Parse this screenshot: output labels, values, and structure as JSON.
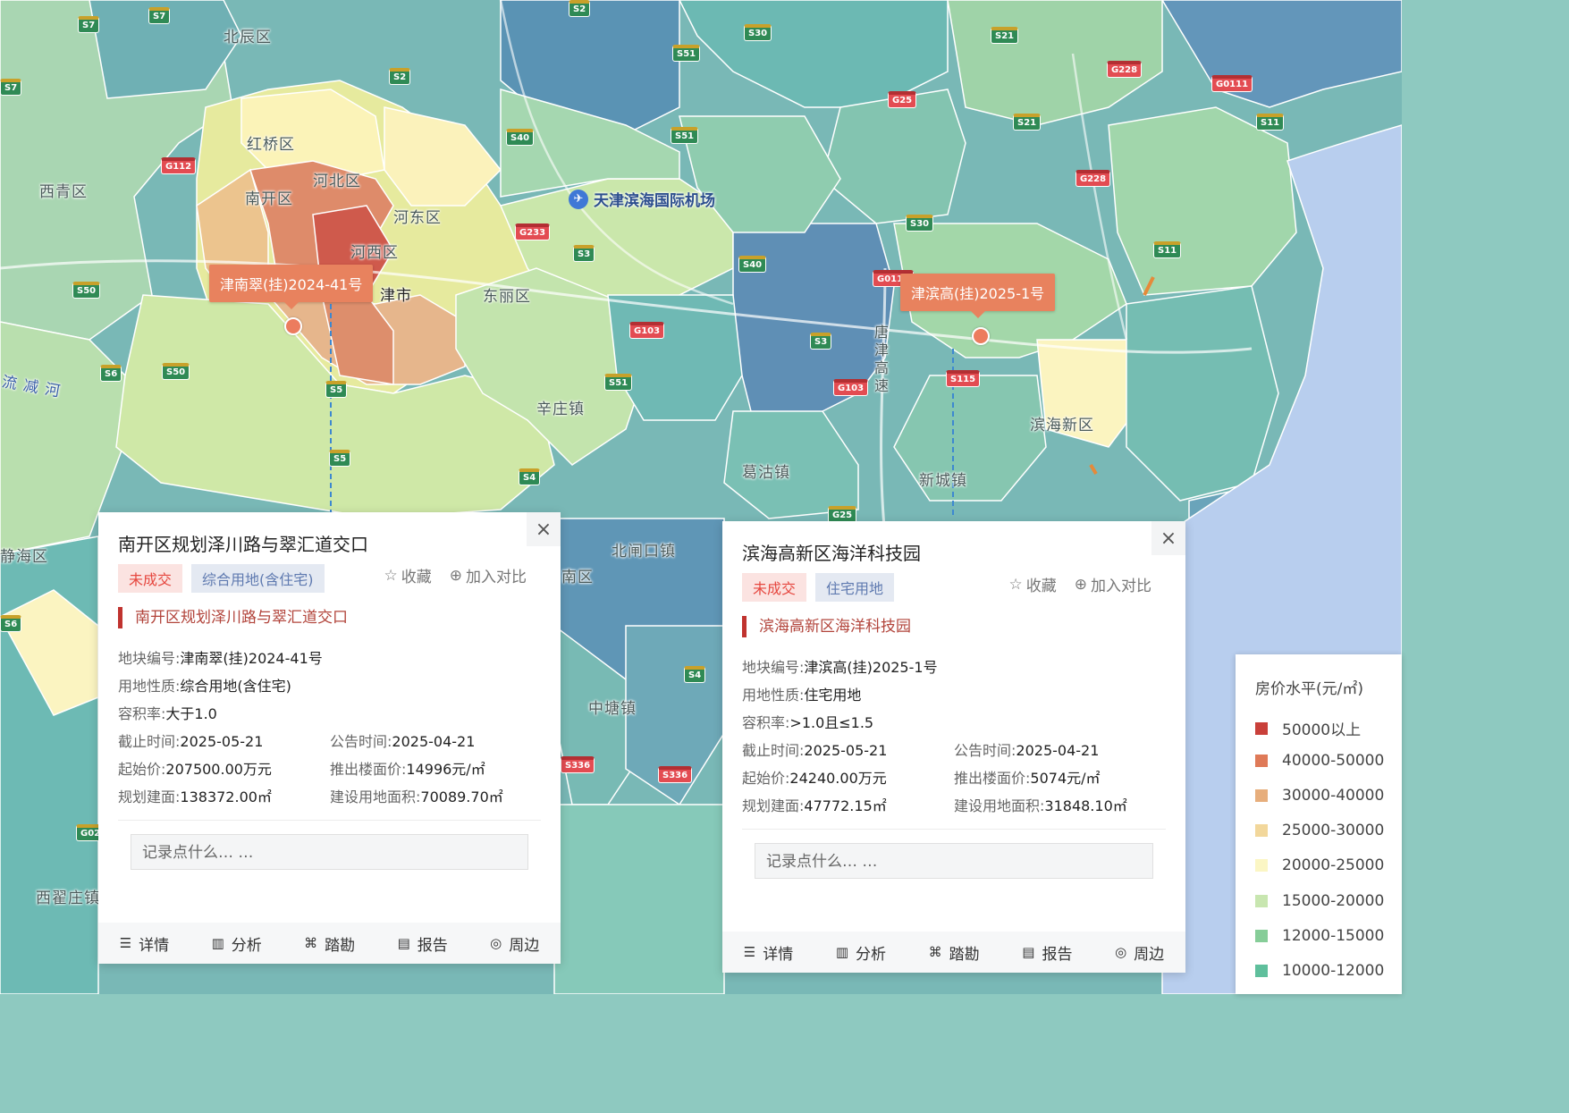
{
  "map": {
    "places": [
      {
        "name": "北辰区"
      },
      {
        "name": "红桥区"
      },
      {
        "name": "河北区"
      },
      {
        "name": "南开区"
      },
      {
        "name": "河东区"
      },
      {
        "name": "河西区"
      },
      {
        "name": "西青区"
      },
      {
        "name": "津市"
      },
      {
        "name": "东丽区"
      },
      {
        "name": "辛庄镇"
      },
      {
        "name": "滨海新区"
      },
      {
        "name": "葛沽镇"
      },
      {
        "name": "新城镇"
      },
      {
        "name": "北闸口镇"
      },
      {
        "name": "中塘镇"
      },
      {
        "name": "西翟庄镇"
      },
      {
        "name": "静海区"
      },
      {
        "name": "南区"
      },
      {
        "name": "流 减 河"
      },
      {
        "name": "唐 津 高 速"
      }
    ],
    "airport": {
      "name": "天津滨海国际机场",
      "icon": "airplane-icon"
    },
    "road_shields": [
      "S7",
      "S7",
      "S2",
      "S30",
      "S21",
      "S51",
      "S2",
      "G25",
      "G228",
      "G0111",
      "S21",
      "S11",
      "S40",
      "S51",
      "G112",
      "G228",
      "S30",
      "S11",
      "G233",
      "S3",
      "S40",
      "G0111",
      "S50",
      "S50",
      "S6",
      "S5",
      "G103",
      "S51",
      "S3",
      "G103",
      "S115",
      "S5",
      "S4",
      "G25",
      "S4",
      "S336",
      "S336",
      "S6",
      "G0211",
      "S7"
    ],
    "callouts": [
      {
        "label": "津南翠(挂)2024-41号"
      },
      {
        "label": "津滨高(挂)2025-1号"
      }
    ]
  },
  "panels": [
    {
      "title": "南开区规划泽川路与翠汇道交口",
      "status_tag": "未成交",
      "type_tag": "综合用地(含住宅)",
      "favorite_label": "收藏",
      "compare_label": "加入对比",
      "subtitle": "南开区规划泽川路与翠汇道交口",
      "fields": {
        "plot_no_k": "地块编号:",
        "plot_no_v": "津南翠(挂)2024-41号",
        "land_use_k": "用地性质:",
        "land_use_v": "综合用地(含住宅)",
        "far_k": "容积率:",
        "far_v": "大于1.0",
        "deadline_k": "截止时间:",
        "deadline_v": "2025-05-21",
        "announce_k": "公告时间:",
        "announce_v": "2025-04-21",
        "start_price_k": "起始价:",
        "start_price_v": "207500.00万元",
        "floor_price_k": "推出楼面价:",
        "floor_price_v": "14996元/㎡",
        "build_area_k": "规划建面:",
        "build_area_v": "138372.00㎡",
        "land_area_k": "建设用地面积:",
        "land_area_v": "70089.70㎡"
      },
      "note_placeholder": "记录点什么… …",
      "toolbar": [
        "详情",
        "分析",
        "踏勘",
        "报告",
        "周边"
      ]
    },
    {
      "title": "滨海高新区海洋科技园",
      "status_tag": "未成交",
      "type_tag": "住宅用地",
      "favorite_label": "收藏",
      "compare_label": "加入对比",
      "subtitle": "滨海高新区海洋科技园",
      "fields": {
        "plot_no_k": "地块编号:",
        "plot_no_v": "津滨高(挂)2025-1号",
        "land_use_k": "用地性质:",
        "land_use_v": "住宅用地",
        "far_k": "容积率:",
        "far_v": ">1.0且≤1.5",
        "deadline_k": "截止时间:",
        "deadline_v": "2025-05-21",
        "announce_k": "公告时间:",
        "announce_v": "2025-04-21",
        "start_price_k": "起始价:",
        "start_price_v": "24240.00万元",
        "floor_price_k": "推出楼面价:",
        "floor_price_v": "5074元/㎡",
        "build_area_k": "规划建面:",
        "build_area_v": "47772.15㎡",
        "land_area_k": "建设用地面积:",
        "land_area_v": "31848.10㎡"
      },
      "note_placeholder": "记录点什么… …",
      "toolbar": [
        "详情",
        "分析",
        "踏勘",
        "报告",
        "周边"
      ]
    }
  ],
  "legend": {
    "title": "房价水平(元/㎡)",
    "items": [
      {
        "label": "50000以上",
        "color": "#c9403a"
      },
      {
        "label": "40000-50000",
        "color": "#df7a58"
      },
      {
        "label": "30000-40000",
        "color": "#e7ae7c"
      },
      {
        "label": "25000-30000",
        "color": "#f2d79b"
      },
      {
        "label": "20000-25000",
        "color": "#fbf6c4"
      },
      {
        "label": "15000-20000",
        "color": "#c8e6b0"
      },
      {
        "label": "12000-15000",
        "color": "#86cd98"
      },
      {
        "label": "10000-12000",
        "color": "#5fbf9c"
      }
    ]
  }
}
